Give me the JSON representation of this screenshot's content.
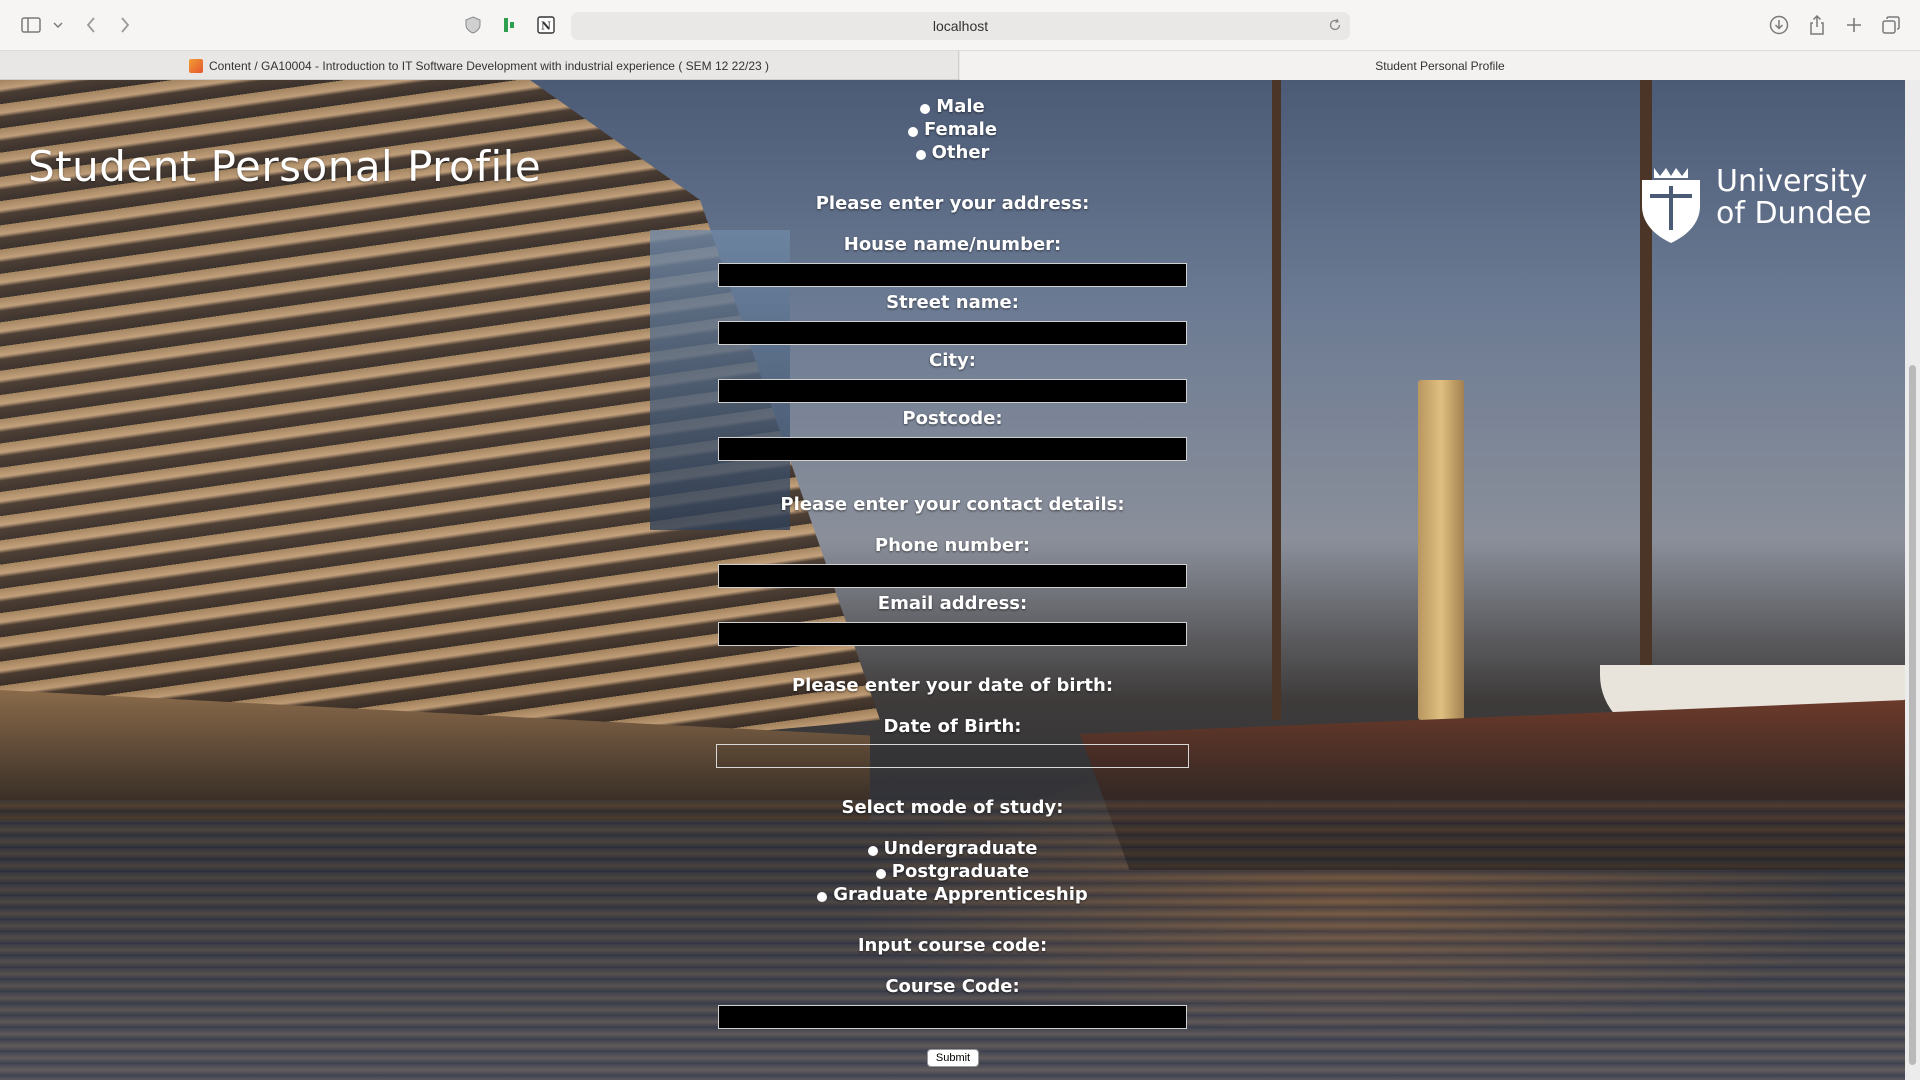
{
  "browser": {
    "address": "localhost",
    "tabs": [
      {
        "label": "Content / GA10004 - Introduction to IT Software Development with industrial experience ( SEM 12 22/23 )"
      },
      {
        "label": "Student Personal Profile"
      }
    ]
  },
  "header": {
    "title": "Student Personal Profile",
    "university_line1": "University",
    "university_line2": "of Dundee"
  },
  "form": {
    "gender_options": [
      "Male",
      "Female",
      "Other"
    ],
    "address_heading": "Please enter your address:",
    "house_label": "House name/number:",
    "street_label": "Street name:",
    "city_label": "City:",
    "postcode_label": "Postcode:",
    "contact_heading": "Please enter your contact details:",
    "phone_label": "Phone number:",
    "email_label": "Email address:",
    "dob_heading": "Please enter your date of birth:",
    "dob_label": "Date of Birth:",
    "study_heading": "Select mode of study:",
    "study_options": [
      "Undergraduate",
      "Postgraduate",
      "Graduate Apprenticeship"
    ],
    "course_heading": "Input course code:",
    "course_label": "Course Code:",
    "submit_label": "Submit"
  }
}
